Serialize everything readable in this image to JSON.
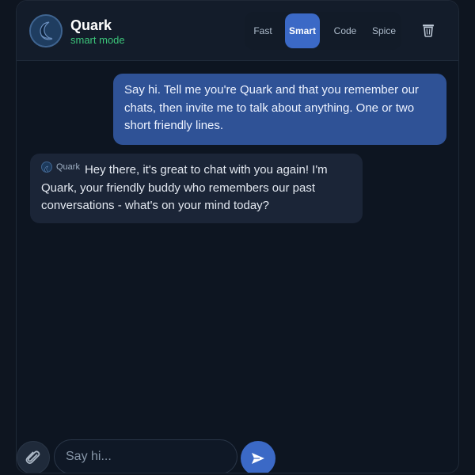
{
  "header": {
    "app_name": "Quark",
    "mode_label": "smart mode",
    "avatar_icon": "moon-icon",
    "trash_icon": "trash-icon"
  },
  "modes": [
    {
      "label": "Fast",
      "active": false
    },
    {
      "label": "Smart",
      "active": true
    },
    {
      "label": "Code",
      "active": false
    },
    {
      "label": "Spice",
      "active": false
    }
  ],
  "messages": [
    {
      "role": "user",
      "text": "Say hi. Tell me you're Quark and that you remember our chats, then invite me to talk about anything. One or two short friendly lines."
    },
    {
      "role": "assistant",
      "sender": "Quark",
      "text": "Hey there, it's great to chat with you again! I'm Quark, your friendly buddy who remembers our past conversations - what's on your mind today?"
    }
  ],
  "composer": {
    "placeholder": "Say hi...",
    "value": "",
    "attach_icon": "paperclip-icon",
    "send_icon": "send-icon"
  },
  "colors": {
    "accent": "#3b69c6",
    "user_bubble": "#2f5296",
    "bot_bubble": "#1b2537",
    "mode_text": "#3cc57a",
    "background": "#0d1521"
  }
}
